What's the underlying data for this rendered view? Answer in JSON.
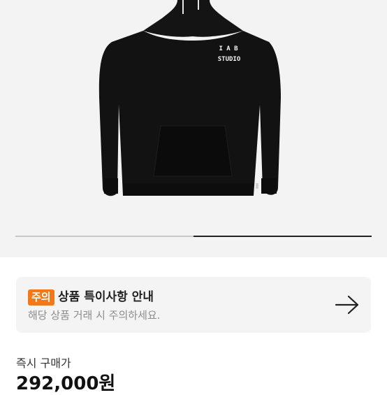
{
  "product": {
    "logo_line1": "I A B",
    "logo_line2": "STUDIO"
  },
  "gallery": {
    "progress": 0.5
  },
  "notice": {
    "badge": "주의",
    "title": "상품 특이사항 안내",
    "description": "해당 상품 거래 시 주의하세요.",
    "arrow_icon": "arrow-right-icon",
    "badge_color": "#f2791a"
  },
  "price": {
    "label": "즉시 구매가",
    "value": "292,000원"
  }
}
